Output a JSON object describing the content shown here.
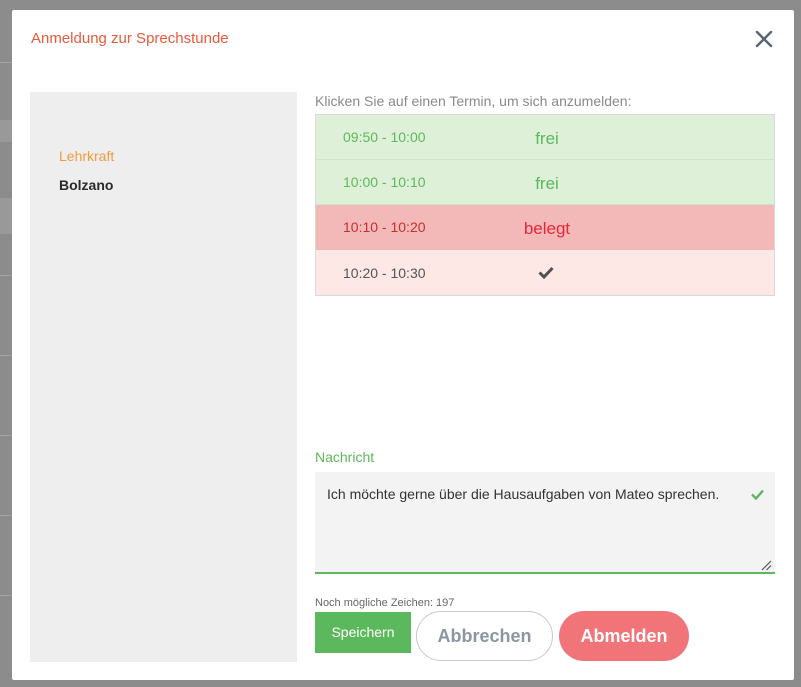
{
  "dialog": {
    "title": "Anmeldung zur Sprechstunde",
    "close_icon": "close-icon"
  },
  "sidebar": {
    "teacher_label": "Lehrkraft",
    "teacher_name": "Bolzano"
  },
  "appointments": {
    "instruction": "Klicken Sie auf einen Termin, um sich anzumelden:",
    "slots": [
      {
        "time": "09:50 - 10:00",
        "status": "frei"
      },
      {
        "time": "10:00 - 10:10",
        "status": "frei"
      },
      {
        "time": "10:10 - 10:20",
        "status": "belegt"
      },
      {
        "time": "10:20 - 10:30",
        "status": "",
        "status_icon": "checkmark-icon"
      }
    ]
  },
  "message": {
    "label": "Nachricht",
    "value": "Ich möchte gerne über die Hausaufgaben von Mateo sprechen.",
    "valid_icon": "checkmark-icon",
    "remaining": "Noch mögliche Zeichen: 197"
  },
  "actions": {
    "save": "Speichern",
    "cancel": "Abbrechen",
    "signoff": "Abmelden"
  },
  "colors": {
    "accent_title": "#e8593d",
    "label_orange": "#f39a3c",
    "success": "#5cb85c",
    "danger": "#e8263a",
    "signoff": "#f07478"
  }
}
